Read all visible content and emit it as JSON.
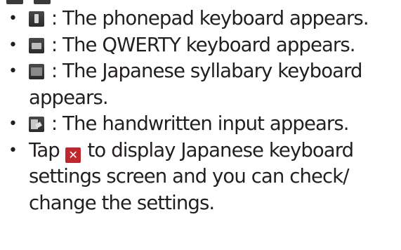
{
  "bullets": [
    {
      "icon": "phonepad-keyboard-icon",
      "lines": [
        ": The phonepad keyboard appears."
      ]
    },
    {
      "icon": "qwerty-keyboard-icon",
      "lines": [
        ": The QWERTY keyboard appears."
      ]
    },
    {
      "icon": "japanese-syllabary-keyboard-icon",
      "lines": [
        ": The Japanese syllabary keyboard",
        "appears."
      ]
    },
    {
      "icon": "handwritten-input-icon",
      "lines": [
        ": The handwritten input appears."
      ]
    },
    {
      "icon": "settings-tools-icon",
      "prefix": "Tap",
      "lines": [
        "to display Japanese keyboard",
        "settings screen and you can check/",
        "change the settings."
      ]
    }
  ],
  "colors": {
    "text": "#231f20",
    "settings_icon": "#c0262d",
    "keyboard_icon": "#3a3a3a"
  }
}
